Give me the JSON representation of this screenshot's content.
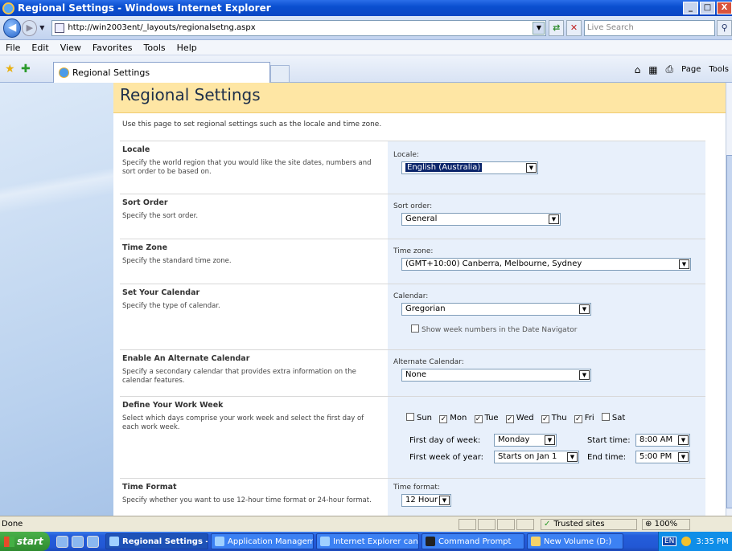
{
  "window": {
    "title": "Regional Settings - Windows Internet Explorer",
    "min": "_",
    "max": "□",
    "close": "X"
  },
  "address": {
    "url": "http://win2003ent/_layouts/regionalsetng.aspx",
    "search_placeholder": "Live Search"
  },
  "menu": [
    "File",
    "Edit",
    "View",
    "Favorites",
    "Tools",
    "Help"
  ],
  "tab": {
    "label": "Regional Settings"
  },
  "cmdbar": {
    "page": "Page",
    "tools": "Tools"
  },
  "page": {
    "title": "Regional Settings",
    "description": "Use this page to set regional settings such as the locale and time zone."
  },
  "sections": {
    "locale": {
      "title": "Locale",
      "desc": "Specify the world region that you would like the site dates, numbers and sort order to be based on.",
      "label": "Locale:",
      "value": "English (Australia)"
    },
    "sort": {
      "title": "Sort Order",
      "desc": "Specify the sort order.",
      "label": "Sort order:",
      "value": "General"
    },
    "timezone": {
      "title": "Time Zone",
      "desc": "Specify the standard time zone.",
      "label": "Time zone:",
      "value": "(GMT+10:00) Canberra, Melbourne, Sydney"
    },
    "calendar": {
      "title": "Set Your Calendar",
      "desc": "Specify the type of calendar.",
      "label": "Calendar:",
      "value": "Gregorian",
      "weeknum_label": "Show week numbers in the Date Navigator"
    },
    "altcal": {
      "title": "Enable An Alternate Calendar",
      "desc": "Specify a secondary calendar that provides extra information on the calendar features.",
      "label": "Alternate Calendar:",
      "value": "None"
    },
    "workweek": {
      "title": "Define Your Work Week",
      "desc": "Select which days comprise your work week and select the first day of each work week.",
      "days": [
        {
          "label": "Sun",
          "checked": false
        },
        {
          "label": "Mon",
          "checked": true
        },
        {
          "label": "Tue",
          "checked": true
        },
        {
          "label": "Wed",
          "checked": true
        },
        {
          "label": "Thu",
          "checked": true
        },
        {
          "label": "Fri",
          "checked": true
        },
        {
          "label": "Sat",
          "checked": false
        }
      ],
      "first_day_label": "First day of week:",
      "first_day_value": "Monday",
      "start_time_label": "Start time:",
      "start_time_value": "8:00 AM",
      "first_week_label": "First week of year:",
      "first_week_value": "Starts on Jan 1",
      "end_time_label": "End time:",
      "end_time_value": "5:00 PM"
    },
    "timeformat": {
      "title": "Time Format",
      "desc": "Specify whether you want to use 12-hour time format or 24-hour format.",
      "label": "Time format:",
      "value": "12 Hour"
    }
  },
  "status": {
    "text": "Done",
    "zone": "Trusted sites",
    "zoom": "100%"
  },
  "taskbar": {
    "start": "start",
    "buttons": [
      "Regional Settings -...",
      "Application Managem...",
      "Internet Explorer can...",
      "Command Prompt",
      "New Volume (D:)"
    ],
    "lang": "EN",
    "clock": "3:35 PM"
  }
}
